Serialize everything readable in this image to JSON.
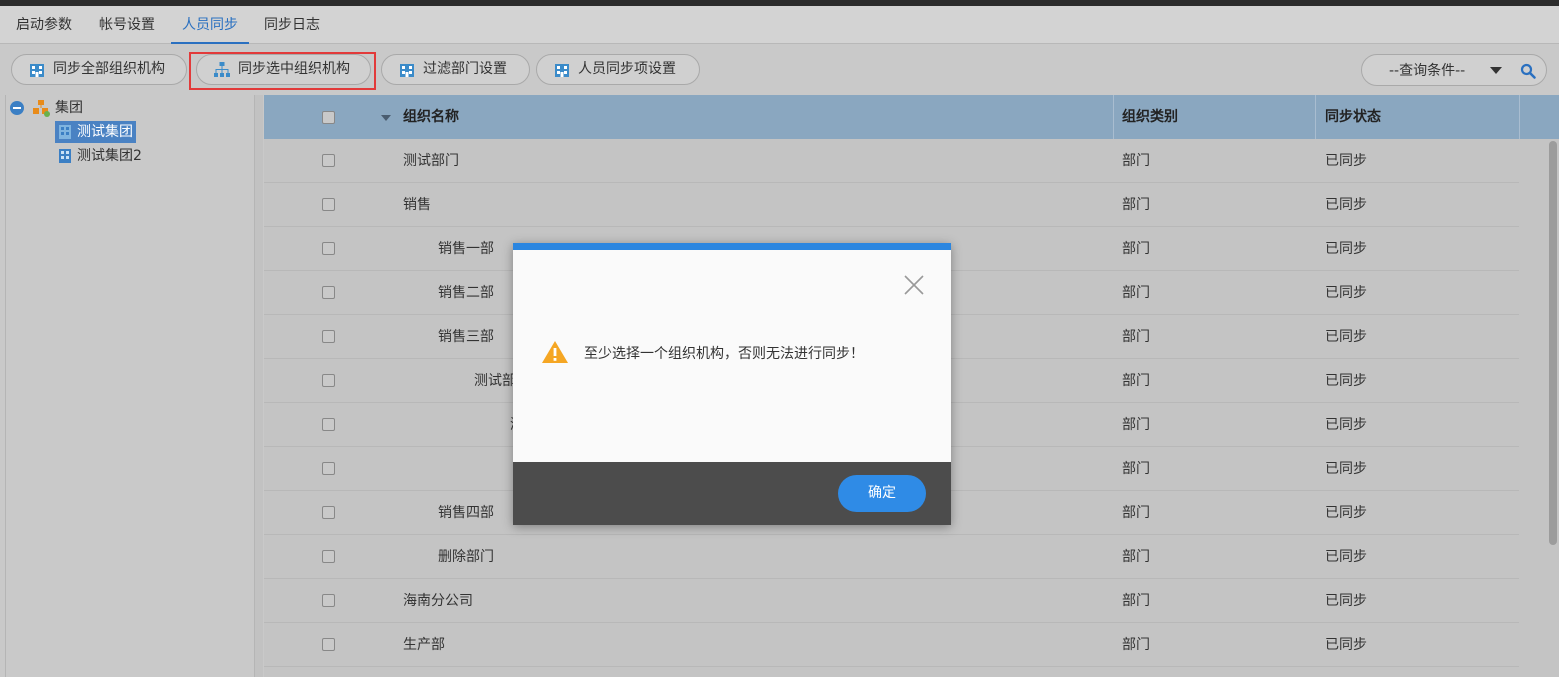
{
  "tabs": [
    {
      "label": "启动参数"
    },
    {
      "label": "帐号设置"
    },
    {
      "label": "人员同步",
      "active": true
    },
    {
      "label": "同步日志"
    }
  ],
  "toolbar": {
    "sync_all": "同步全部组织机构",
    "sync_selected": "同步选中组织机构",
    "filter_dept": "过滤部门设置",
    "sync_items": "人员同步项设置",
    "query_placeholder": "--查询条件--"
  },
  "tree": {
    "root": "集团",
    "children": [
      "测试集团",
      "测试集团2"
    ],
    "selected": "测试集团"
  },
  "grid": {
    "columns": {
      "name": "组织名称",
      "type": "组织类别",
      "status": "同步状态"
    },
    "rows": [
      {
        "name": "测试部门",
        "type": "部门",
        "status": "已同步",
        "indent": 0
      },
      {
        "name": "销售",
        "type": "部门",
        "status": "已同步",
        "indent": 0
      },
      {
        "name": "销售一部",
        "type": "部门",
        "status": "已同步",
        "indent": 1
      },
      {
        "name": "销售二部",
        "type": "部门",
        "status": "已同步",
        "indent": 1
      },
      {
        "name": "销售三部",
        "type": "部门",
        "status": "已同步",
        "indent": 1
      },
      {
        "name": "测试部",
        "type": "部门",
        "status": "已同步",
        "indent": 2
      },
      {
        "name": "测",
        "type": "部门",
        "status": "已同步",
        "indent": 3
      },
      {
        "name": "",
        "type": "部门",
        "status": "已同步",
        "indent": 0
      },
      {
        "name": "销售四部",
        "type": "部门",
        "status": "已同步",
        "indent": 1
      },
      {
        "name": "删除部门",
        "type": "部门",
        "status": "已同步",
        "indent": 1
      },
      {
        "name": "海南分公司",
        "type": "部门",
        "status": "已同步",
        "indent": 0
      },
      {
        "name": "生产部",
        "type": "部门",
        "status": "已同步",
        "indent": 0
      }
    ]
  },
  "dialog": {
    "message": "至少选择一个组织机构，否则无法进行同步！",
    "ok_label": "确定"
  },
  "colors": {
    "accent": "#2a70c0",
    "dialog_blue": "#2f8be6",
    "header_blue": "#8aa7c0",
    "warning": "#f5a623",
    "highlight": "#e23a3a"
  }
}
